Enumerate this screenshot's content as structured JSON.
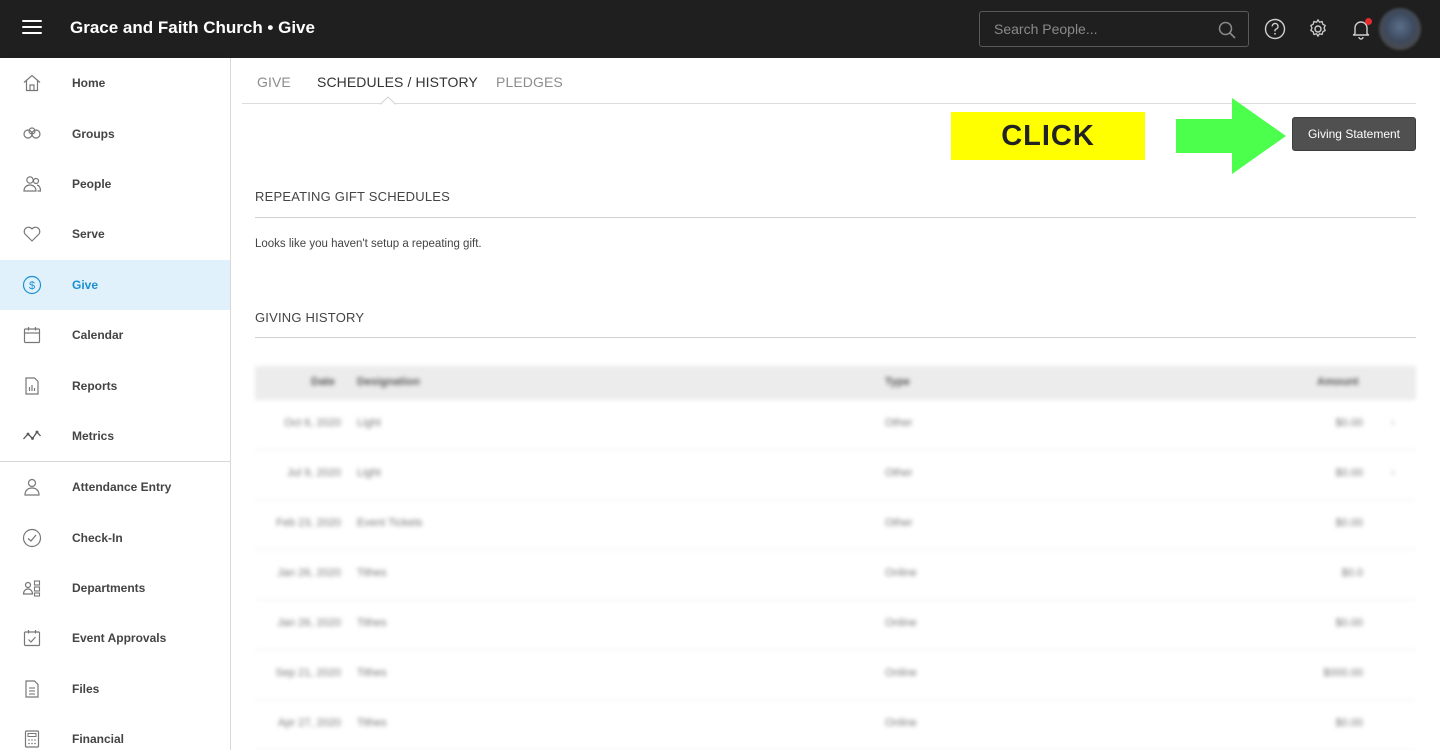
{
  "header": {
    "title": "Grace and Faith Church • Give",
    "search_placeholder": "Search People..."
  },
  "sidebar": {
    "items": [
      {
        "label": "Home",
        "icon": "home-icon"
      },
      {
        "label": "Groups",
        "icon": "groups-icon"
      },
      {
        "label": "People",
        "icon": "people-icon"
      },
      {
        "label": "Serve",
        "icon": "heart-icon"
      },
      {
        "label": "Give",
        "icon": "dollar-icon",
        "active": true
      },
      {
        "label": "Calendar",
        "icon": "calendar-icon"
      },
      {
        "label": "Reports",
        "icon": "report-icon"
      },
      {
        "label": "Metrics",
        "icon": "metrics-icon"
      },
      {
        "label": "Attendance Entry",
        "icon": "attendance-icon"
      },
      {
        "label": "Check-In",
        "icon": "check-circle-icon"
      },
      {
        "label": "Departments",
        "icon": "departments-icon"
      },
      {
        "label": "Event Approvals",
        "icon": "calendar-check-icon"
      },
      {
        "label": "Files",
        "icon": "file-icon"
      },
      {
        "label": "Financial",
        "icon": "calculator-icon"
      }
    ]
  },
  "tabs": [
    {
      "label": "GIVE"
    },
    {
      "label": "SCHEDULES / HISTORY",
      "active": true
    },
    {
      "label": "PLEDGES"
    }
  ],
  "annotation": {
    "click_label": "CLICK",
    "arrow_color": "#4cff4c",
    "banner_color": "#ffff00"
  },
  "actions": {
    "giving_statement": "Giving Statement"
  },
  "repeating": {
    "title": "REPEATING GIFT SCHEDULES",
    "empty_message": "Looks like you haven't setup a repeating gift."
  },
  "history": {
    "title": "GIVING HISTORY",
    "columns": [
      "Date",
      "Designation",
      "Type",
      "Amount"
    ],
    "rows": [
      {
        "date": "Oct 6, 2020",
        "designation": "Light",
        "type": "Other",
        "amount": "$0.00",
        "chevron": "›"
      },
      {
        "date": "Jul 9, 2020",
        "designation": "Light",
        "type": "Other",
        "amount": "$0.00",
        "chevron": "›"
      },
      {
        "date": "Feb 23, 2020",
        "designation": "Event Tickets",
        "type": "Other",
        "amount": "$0.00",
        "chevron": ""
      },
      {
        "date": "Jan 26, 2020",
        "designation": "Tithes",
        "type": "Online",
        "amount": "$0.0",
        "chevron": ""
      },
      {
        "date": "Jan 26, 2020",
        "designation": "Tithes",
        "type": "Online",
        "amount": "$0.00",
        "chevron": ""
      },
      {
        "date": "Sep 21, 2020",
        "designation": "Tithes",
        "type": "Online",
        "amount": "$000.00",
        "chevron": ""
      },
      {
        "date": "Apr 27, 2020",
        "designation": "Tithes",
        "type": "Online",
        "amount": "$0.00",
        "chevron": ""
      }
    ]
  },
  "colors": {
    "topbar": "#1f1f1f",
    "active_nav_bg": "#e1f1fb",
    "active_nav_text": "#1a8fd4",
    "button_bg": "#505050",
    "notification_dot": "#e52b2b"
  }
}
